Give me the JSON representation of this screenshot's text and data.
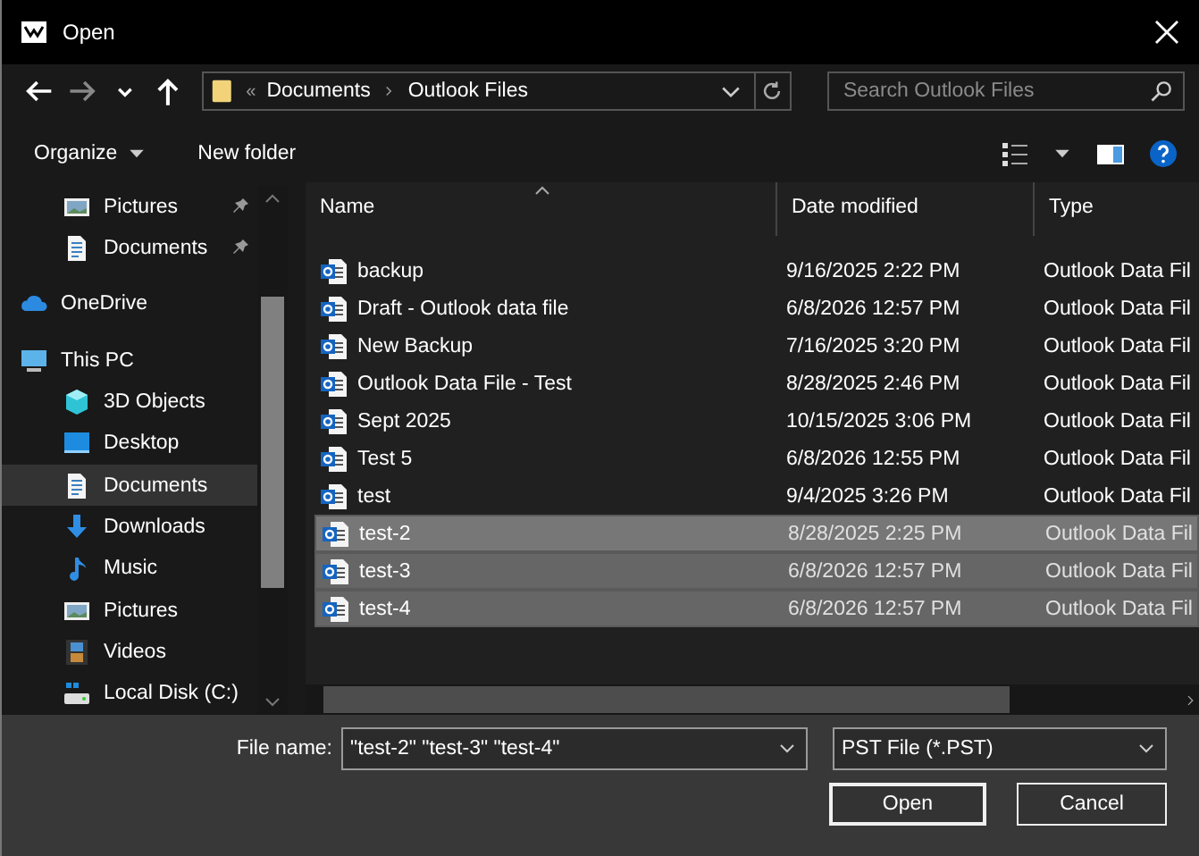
{
  "window": {
    "title": "Open"
  },
  "navigation": {
    "path": [
      "Documents",
      "Outlook Files"
    ],
    "overflow": "«",
    "search_placeholder": "Search Outlook Files"
  },
  "toolbar": {
    "organize": "Organize",
    "new_folder": "New folder"
  },
  "sidebar": {
    "items": [
      {
        "label": "Pictures",
        "kind": "pictures",
        "pinned": true,
        "selected": false,
        "indented": true
      },
      {
        "label": "Documents",
        "kind": "documents",
        "pinned": true,
        "selected": false,
        "indented": true
      },
      {
        "label": "OneDrive",
        "kind": "cloud",
        "pinned": false,
        "selected": false,
        "indented": false
      },
      {
        "label": "This PC",
        "kind": "pc",
        "pinned": false,
        "selected": false,
        "indented": false,
        "children": [
          {
            "label": "3D Objects",
            "kind": "cube",
            "pinned": false,
            "selected": false
          },
          {
            "label": "Desktop",
            "kind": "desktop",
            "pinned": false,
            "selected": false
          },
          {
            "label": "Documents",
            "kind": "documents",
            "pinned": false,
            "selected": true
          },
          {
            "label": "Downloads",
            "kind": "downloads",
            "pinned": false,
            "selected": false
          },
          {
            "label": "Music",
            "kind": "music",
            "pinned": false,
            "selected": false
          },
          {
            "label": "Pictures",
            "kind": "pictures",
            "pinned": false,
            "selected": false
          },
          {
            "label": "Videos",
            "kind": "videos",
            "pinned": false,
            "selected": false
          },
          {
            "label": "Local Disk (C:)",
            "kind": "disk",
            "pinned": false,
            "selected": false
          }
        ]
      }
    ]
  },
  "table": {
    "columns": [
      "Name",
      "Date modified",
      "Type"
    ],
    "rows": [
      {
        "name": "backup",
        "date": "9/16/2025 2:22 PM",
        "type": "Outlook Data Fil",
        "selected": false
      },
      {
        "name": "Draft - Outlook data file",
        "date": "6/8/2026 12:57 PM",
        "type": "Outlook Data Fil",
        "selected": false
      },
      {
        "name": "New Backup",
        "date": "7/16/2025 3:20 PM",
        "type": "Outlook Data Fil",
        "selected": false
      },
      {
        "name": "Outlook Data File - Test",
        "date": "8/28/2025 2:46 PM",
        "type": "Outlook Data Fil",
        "selected": false
      },
      {
        "name": "Sept 2025",
        "date": "10/15/2025 3:06 PM",
        "type": "Outlook Data Fil",
        "selected": false
      },
      {
        "name": "Test 5",
        "date": "6/8/2026 12:55 PM",
        "type": "Outlook Data Fil",
        "selected": false
      },
      {
        "name": "test",
        "date": "9/4/2025 3:26 PM",
        "type": "Outlook Data Fil",
        "selected": false
      },
      {
        "name": "test-2",
        "date": "8/28/2025 2:25 PM",
        "type": "Outlook Data Fil",
        "selected": true
      },
      {
        "name": "test-3",
        "date": "6/8/2026 12:57 PM",
        "type": "Outlook Data Fil",
        "selected": true
      },
      {
        "name": "test-4",
        "date": "6/8/2026 12:57 PM",
        "type": "Outlook Data Fil",
        "selected": true
      }
    ]
  },
  "footer": {
    "file_name_label": "File name:",
    "file_name": "\"test-2\" \"test-3\" \"test-4\"",
    "filter": "PST File (*.PST)",
    "buttons": [
      "Open",
      "Cancel"
    ]
  }
}
